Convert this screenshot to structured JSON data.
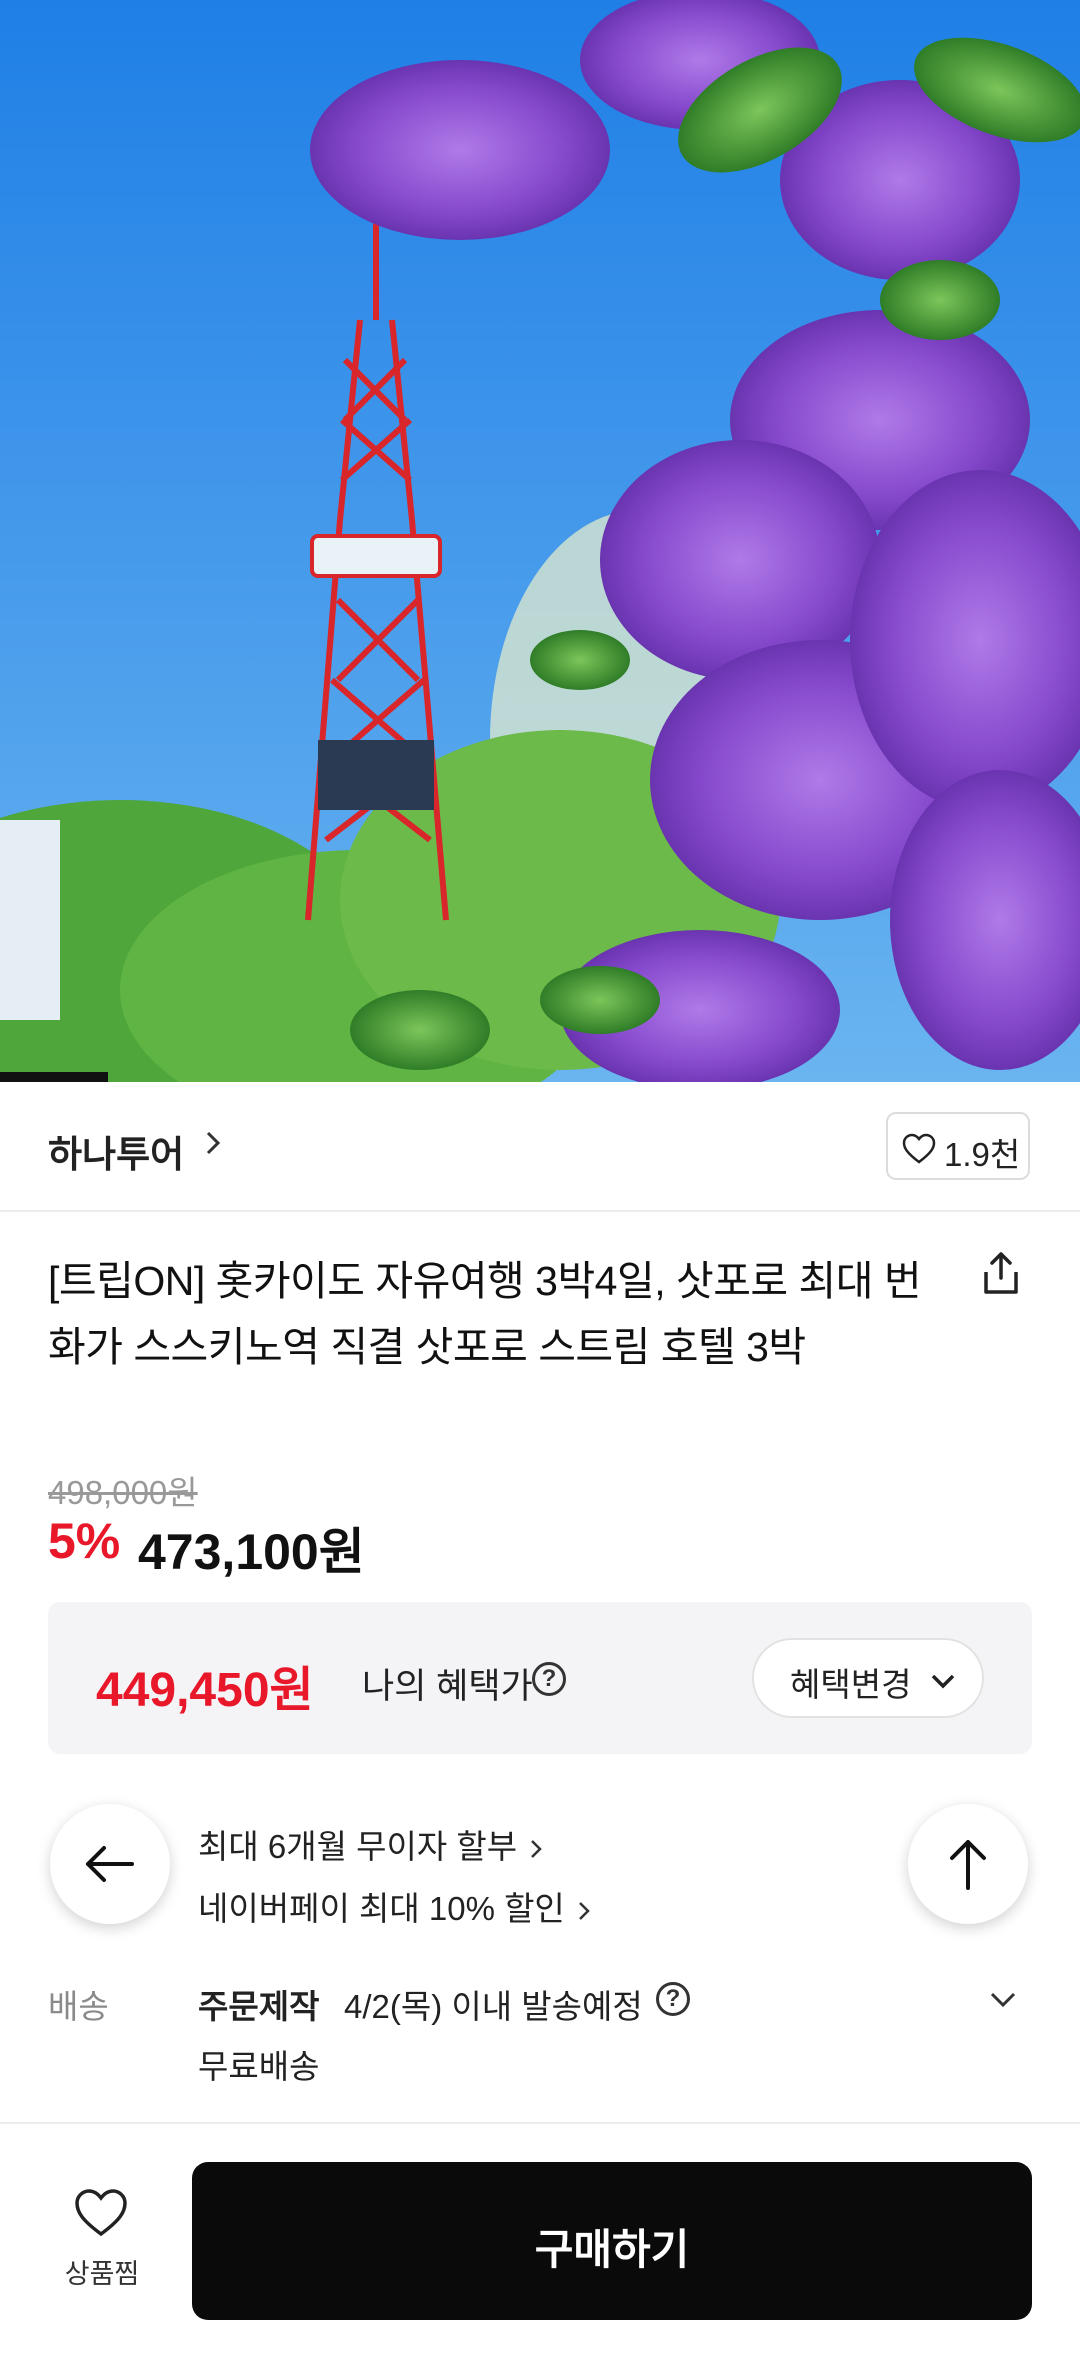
{
  "hero": {
    "image_description_icon": "sapporo-tower-lilac-photo",
    "colors": {
      "sky": "#2f8ae6",
      "tower": "#d8262b",
      "lilac": "#8a4fd0",
      "leaf": "#3d9a32"
    }
  },
  "seller": {
    "name": "하나투어",
    "like_count": "1.9천"
  },
  "product": {
    "title": "[트립ON] 홋카이도 자유여행 3박4일, 삿포로 최대 번화가 스스키노역 직결 삿포로 스트림 호텔 3박",
    "original_price": "498,000원",
    "discount_rate": "5%",
    "sale_price": "473,100원"
  },
  "benefit": {
    "price": "449,450원",
    "label": "나의 혜택가",
    "change_button": "혜택변경"
  },
  "info": {
    "installment": "최대 6개월 무이자 할부",
    "naverpay": "네이버페이 최대 10% 할인",
    "shipping_label": "배송",
    "shipping_type": "주문제작",
    "shipping_date": "4/2(목) 이내 발송예정",
    "shipping_fee": "무료배송"
  },
  "bottom": {
    "wish_label": "상품찜",
    "buy_label": "구매하기"
  },
  "accent": {
    "red": "#e8182a",
    "black": "#0a0a0a"
  }
}
